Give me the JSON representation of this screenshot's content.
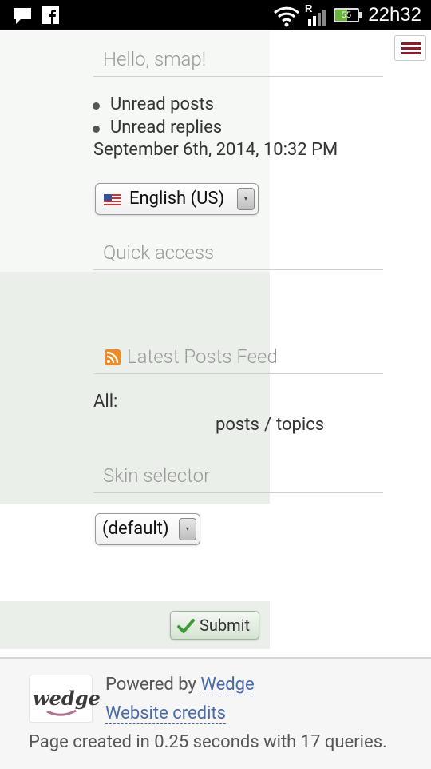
{
  "statusbar": {
    "time": "22h32",
    "battery_level": "55",
    "network_badge": "R",
    "icons": [
      "chat-icon",
      "facebook-icon",
      "wifi-icon",
      "signal-icon",
      "battery-icon"
    ]
  },
  "colors": {
    "link": "#3f6fa0",
    "menu_icon": "#8b1b2b",
    "panel_bg": "#f2f6f1",
    "muted_title": "#999999"
  },
  "user_box": {
    "title": "Hello, smap!",
    "links": [
      "Unread posts",
      "Unread replies"
    ],
    "datetime": "September 6th, 2014, 10:32 PM"
  },
  "language_select": {
    "selected": "English (US)",
    "flag": "us-flag-icon"
  },
  "quick_access": {
    "title": "Quick access"
  },
  "feed": {
    "title": "Latest Posts Feed",
    "all_label": "All:",
    "posts_label": "posts",
    "separator": "/",
    "topics_label": "topics"
  },
  "skin_selector": {
    "title": "Skin selector",
    "selected": "(default)"
  },
  "submit": {
    "label": "Submit"
  },
  "footer": {
    "logo_text": "wedge",
    "powered_by_prefix": "Powered by",
    "powered_by_link": "Wedge",
    "credits_link": "Website credits",
    "page_created": "Page created in 0.25 seconds with 17 queries."
  }
}
